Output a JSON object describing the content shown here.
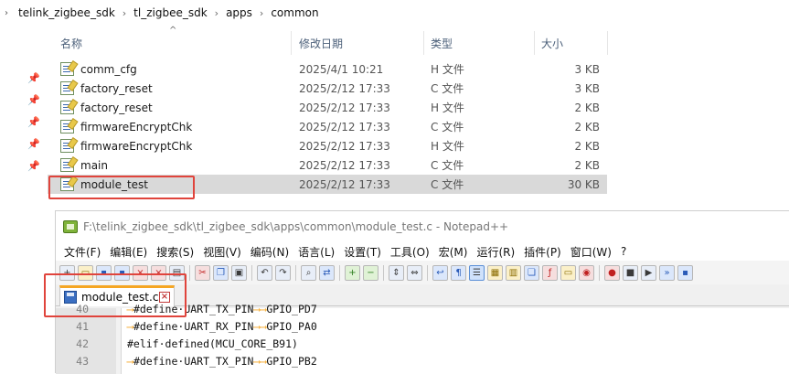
{
  "explorer": {
    "breadcrumb": [
      "telink_zigbee_sdk",
      "tl_zigbee_sdk",
      "apps",
      "common"
    ],
    "columns": {
      "name": "名称",
      "modified": "修改日期",
      "type": "类型",
      "size": "大小"
    },
    "files": [
      {
        "name": "comm_cfg",
        "modified": "2025/4/1 10:21",
        "type": "H 文件",
        "size": "3 KB"
      },
      {
        "name": "factory_reset",
        "modified": "2025/2/12 17:33",
        "type": "C 文件",
        "size": "3 KB"
      },
      {
        "name": "factory_reset",
        "modified": "2025/2/12 17:33",
        "type": "H 文件",
        "size": "2 KB"
      },
      {
        "name": "firmwareEncryptChk",
        "modified": "2025/2/12 17:33",
        "type": "C 文件",
        "size": "2 KB"
      },
      {
        "name": "firmwareEncryptChk",
        "modified": "2025/2/12 17:33",
        "type": "H 文件",
        "size": "2 KB"
      },
      {
        "name": "main",
        "modified": "2025/2/12 17:33",
        "type": "C 文件",
        "size": "2 KB"
      },
      {
        "name": "module_test",
        "modified": "2025/2/12 17:33",
        "type": "C 文件",
        "size": "30 KB"
      }
    ]
  },
  "notepad": {
    "title": "F:\\telink_zigbee_sdk\\tl_zigbee_sdk\\apps\\common\\module_test.c - Notepad++",
    "menu": [
      "文件(F)",
      "编辑(E)",
      "搜索(S)",
      "视图(V)",
      "编码(N)",
      "语言(L)",
      "设置(T)",
      "工具(O)",
      "宏(M)",
      "运行(R)",
      "插件(P)",
      "窗口(W)",
      "?"
    ],
    "tab_label": "module_test.c",
    "lines": [
      {
        "num": "40",
        "code": "#define·UART_TX_PIN",
        "value": "GPIO_PD7"
      },
      {
        "num": "41",
        "code": "#define·UART_RX_PIN",
        "value": "GPIO_PA0"
      },
      {
        "num": "42",
        "code": "#elif·defined(MCU_CORE_B91)",
        "value": ""
      },
      {
        "num": "43",
        "code": "#define·UART_TX_PIN",
        "value": "GPIO_PB2"
      }
    ]
  }
}
